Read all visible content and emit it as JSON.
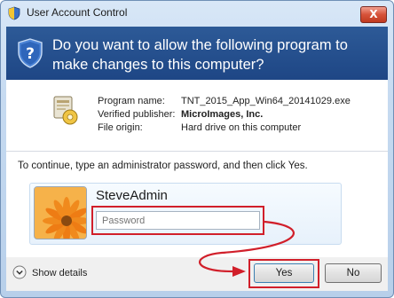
{
  "window": {
    "title": "User Account Control",
    "close_label": "X"
  },
  "header": {
    "question": "Do you want to allow the following program to make changes to this computer?"
  },
  "program": {
    "rows": [
      {
        "label": "Program name:",
        "value": "TNT_2015_App_Win64_20141029.exe",
        "bold": false
      },
      {
        "label": "Verified publisher:",
        "value": "MicroImages, Inc.",
        "bold": true
      },
      {
        "label": "File origin:",
        "value": "Hard drive on this computer",
        "bold": false
      }
    ]
  },
  "prompt": "To continue, type an administrator password, and then click Yes.",
  "credentials": {
    "username": "SteveAdmin",
    "password_placeholder": "Password"
  },
  "footer": {
    "show_details_label": "Show details",
    "yes_label": "Yes",
    "no_label": "No"
  },
  "colors": {
    "header_blue": "#1e4685",
    "annotation_red": "#d11f2a",
    "close_red": "#c03a20"
  }
}
